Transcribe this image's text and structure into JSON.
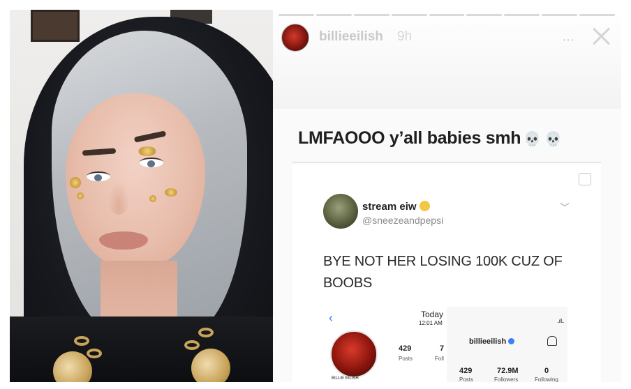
{
  "story": {
    "username": "billieeilish",
    "time": "9h",
    "more_label": "···",
    "caption": "LMFAOOO y’all babies smh",
    "caption_emoji": "💀 💀"
  },
  "tweet": {
    "display_name": "stream eiw",
    "handle": "@sneezeandpepsi",
    "chevron": "﹀",
    "text_line1": "BYE NOT HER LOSING 100K CUZ OF",
    "text_line2": "BOOBS"
  },
  "embedded_profile_left": {
    "back_glyph": "‹",
    "today_label": "Today",
    "today_time": "12:01 AM",
    "posts_count": "429",
    "posts_label": "Posts",
    "followers_count_partial": "7",
    "followers_label_partial": "Foll",
    "name": "BILLIE EILISH"
  },
  "embedded_profile_right": {
    "username": "billieeilish",
    "signal": "..ıl L",
    "posts_count": "429",
    "posts_label": "Posts",
    "followers_count": "72.9M",
    "followers_label": "Followers",
    "following_count": "0",
    "following_label": "Following"
  },
  "colors": {
    "accent_blue": "#3b82f6",
    "header_text": "#c9c9c9"
  },
  "icons": [
    "more-options-icon",
    "close-icon",
    "skull-emoji-icon",
    "angry-emoji-icon",
    "chevron-down-icon",
    "back-icon",
    "verified-badge-icon",
    "notification-bell-icon"
  ]
}
